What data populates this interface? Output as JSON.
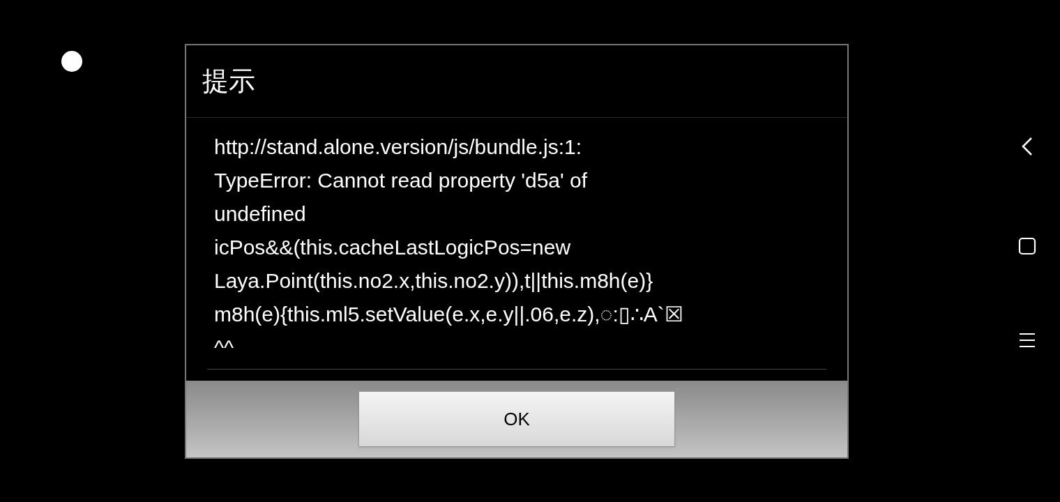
{
  "dialog": {
    "title": "提示",
    "message_lines": [
      "http://stand.alone.version/js/bundle.js:1:",
      "TypeError: Cannot read property 'd5a' of",
      "undefined",
      "icPos&&(this.cacheLastLogicPos=new",
      "Laya.Point(this.no2.x,this.no2.y)),t||this.m8h(e)}",
      "m8h(e){this.ml5.setValue(e.x,e.y||.06,e.z),◌:▯∴A`☒",
      "^^"
    ],
    "buttons": [
      {
        "label": "OK"
      }
    ]
  }
}
